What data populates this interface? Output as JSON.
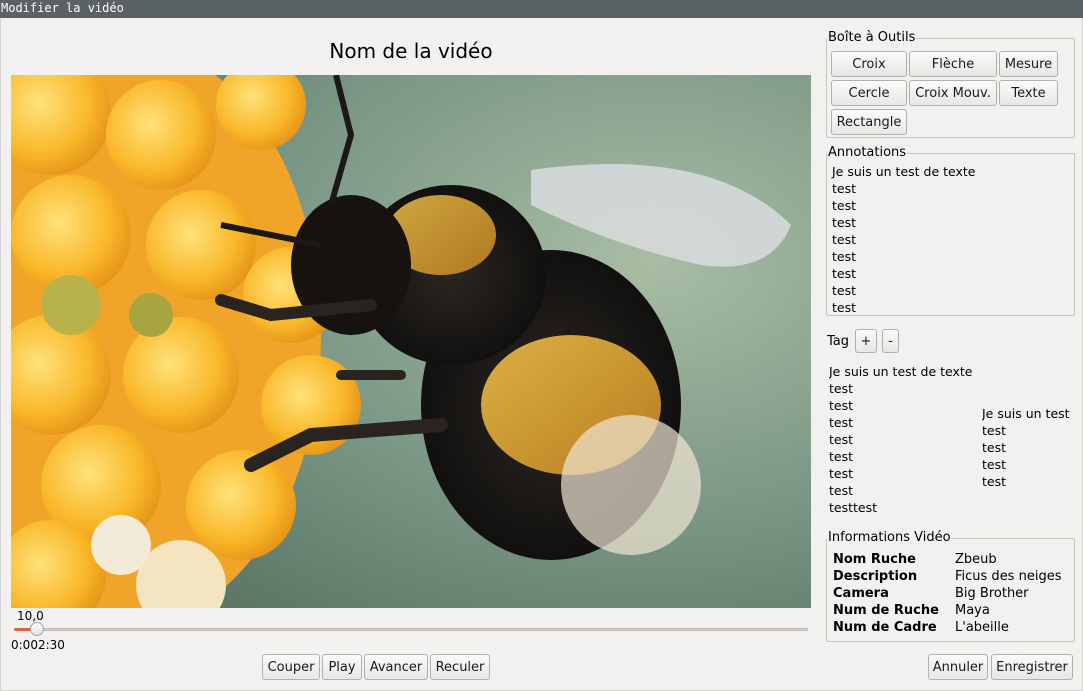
{
  "window": {
    "title": "Modifier la vidéo"
  },
  "video": {
    "title": "Nom de la vidéo",
    "frame_label": "10,0",
    "time": "0:002:30",
    "progress_fraction": 0.02
  },
  "controls": {
    "couper": "Couper",
    "play": "Play",
    "avancer": "Avancer",
    "reculer": "Reculer"
  },
  "toolbox": {
    "title": "Boîte à Outils",
    "tools": [
      "Croix",
      "Flèche",
      "Mesure",
      "Cercle",
      "Croix Mouv.",
      "Texte",
      "Rectangle"
    ]
  },
  "annotations": {
    "title": "Annotations",
    "lines": [
      "Je suis un test de texte",
      "test",
      "test",
      "test",
      "test",
      "test",
      "test",
      "test",
      "test"
    ]
  },
  "tags": {
    "label": "Tag",
    "add": "+",
    "remove": "-",
    "left_lines": [
      "Je suis un test de texte",
      "test",
      "test",
      "test",
      "test",
      "test",
      "test",
      "test",
      "testtest"
    ],
    "right_lines": [
      "Je suis un test",
      "test",
      "test",
      "test",
      "test"
    ]
  },
  "info": {
    "title": "Informations Vidéo",
    "rows": [
      {
        "key": "Nom Ruche",
        "value": "Zbeub"
      },
      {
        "key": "Description",
        "value": "Ficus des neiges"
      },
      {
        "key": "Camera",
        "value": "Big Brother"
      },
      {
        "key": "Num de Ruche",
        "value": "Maya"
      },
      {
        "key": "Num de Cadre",
        "value": "L'abeille"
      }
    ]
  },
  "actions": {
    "annuler": "Annuler",
    "enregistrer": "Enregistrer"
  },
  "colors": {
    "accent": "#e2623b",
    "titlebar": "#5a6266",
    "background": "#f2f1f0"
  }
}
